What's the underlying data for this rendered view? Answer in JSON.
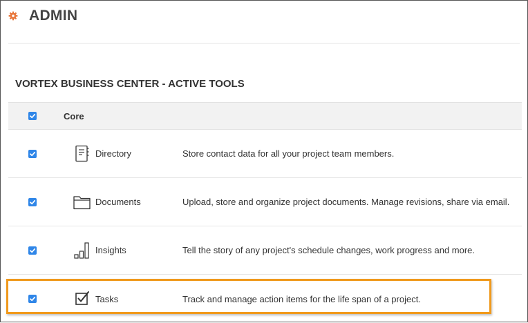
{
  "header": {
    "title": "ADMIN",
    "icon": "gear-icon",
    "icon_color": "#e8763a"
  },
  "section": {
    "title": "VORTEX BUSINESS CENTER - ACTIVE TOOLS"
  },
  "core": {
    "label": "Core",
    "checked": true
  },
  "tools": [
    {
      "name": "Directory",
      "icon": "directory-icon",
      "description": "Store contact data for all your project team members.",
      "checked": true
    },
    {
      "name": "Documents",
      "icon": "folder-icon",
      "description": "Upload, store and organize project documents. Manage revisions, share via email.",
      "checked": true
    },
    {
      "name": "Insights",
      "icon": "bar-chart-icon",
      "description": "Tell the story of any project's schedule changes, work progress and more.",
      "checked": true
    },
    {
      "name": "Tasks",
      "icon": "checkbox-icon",
      "description": "Track and manage action items for the life span of a project.",
      "checked": true,
      "highlighted": true
    }
  ],
  "colors": {
    "checkbox": "#2f86e8",
    "highlight": "#f0991c"
  }
}
